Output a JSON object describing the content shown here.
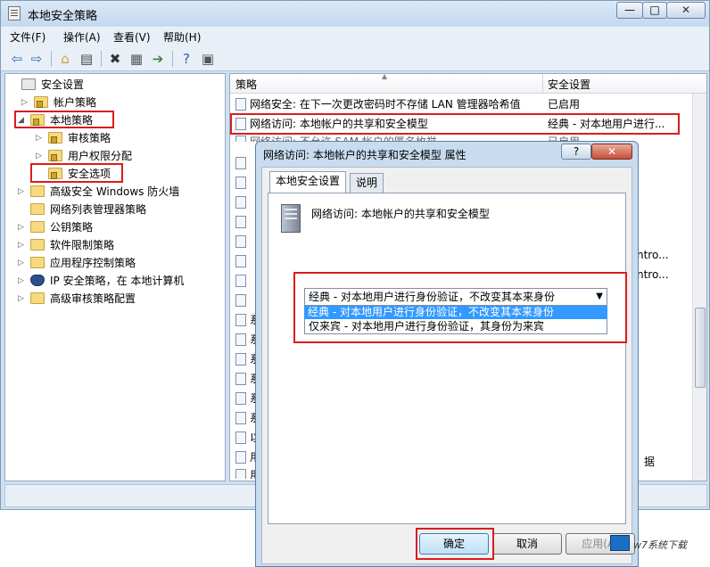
{
  "window": {
    "title": "本地安全策略",
    "min_label": "—",
    "max_label": "□",
    "close_label": "✕"
  },
  "menu": [
    "文件(F)",
    "操作(A)",
    "查看(V)",
    "帮助(H)"
  ],
  "toolbar_icons": [
    "back-icon",
    "forward-icon",
    "up-folder-icon",
    "show-tree-icon",
    "delete-icon",
    "properties-icon",
    "export-icon",
    "help-icon",
    "console-icon"
  ],
  "tree": {
    "items": [
      {
        "label": "安全设置",
        "arrow": ""
      },
      {
        "label": "帐户策略",
        "arrow": "▷"
      },
      {
        "label": "本地策略",
        "arrow": "◢"
      },
      {
        "label": "审核策略",
        "arrow": "▷"
      },
      {
        "label": "用户权限分配",
        "arrow": "▷"
      },
      {
        "label": "安全选项",
        "arrow": ""
      },
      {
        "label": "高级安全 Windows 防火墙",
        "arrow": "▷"
      },
      {
        "label": "网络列表管理器策略",
        "arrow": ""
      },
      {
        "label": "公钥策略",
        "arrow": "▷"
      },
      {
        "label": "软件限制策略",
        "arrow": "▷"
      },
      {
        "label": "应用程序控制策略",
        "arrow": "▷"
      },
      {
        "label": "IP 安全策略，在 本地计算机",
        "arrow": "▷"
      },
      {
        "label": "高级审核策略配置",
        "arrow": "▷"
      }
    ]
  },
  "list": {
    "col_policy": "策略",
    "col_setting": "安全设置",
    "rows": [
      {
        "name": "网络安全: 在下一次更改密码时不存储 LAN 管理器哈希值",
        "value": "已启用"
      },
      {
        "name": "网络访问: 本地帐户的共享和安全模型",
        "value": "经典 - 对本地用户进行..."
      },
      {
        "name": "网络访问: 不允许 SAM 帐户的匿名枚举",
        "value": "已启用"
      }
    ],
    "partial_right": [
      "ntro...",
      "ntro...",
      "据"
    ],
    "partial_left": [
      "系",
      "系",
      "系",
      "系",
      "系",
      "系",
      "以",
      "用",
      "用"
    ]
  },
  "dialog": {
    "title": "网络访问: 本地帐户的共享和安全模型 属性",
    "help_label": "?",
    "close_label": "✕",
    "tabs": [
      "本地安全设置",
      "说明"
    ],
    "policy_name": "网络访问: 本地帐户的共享和安全模型",
    "combo_value": "经典 - 对本地用户进行身份验证，不改变其本来身份",
    "options": [
      "经典 - 对本地用户进行身份验证，不改变其本来身份",
      "仅来宾 - 对本地用户进行身份验证，其身份为来宾"
    ],
    "ok_label": "确定",
    "cancel_label": "取消",
    "apply_label": "应用(A)"
  },
  "watermark": "w7系统下载"
}
